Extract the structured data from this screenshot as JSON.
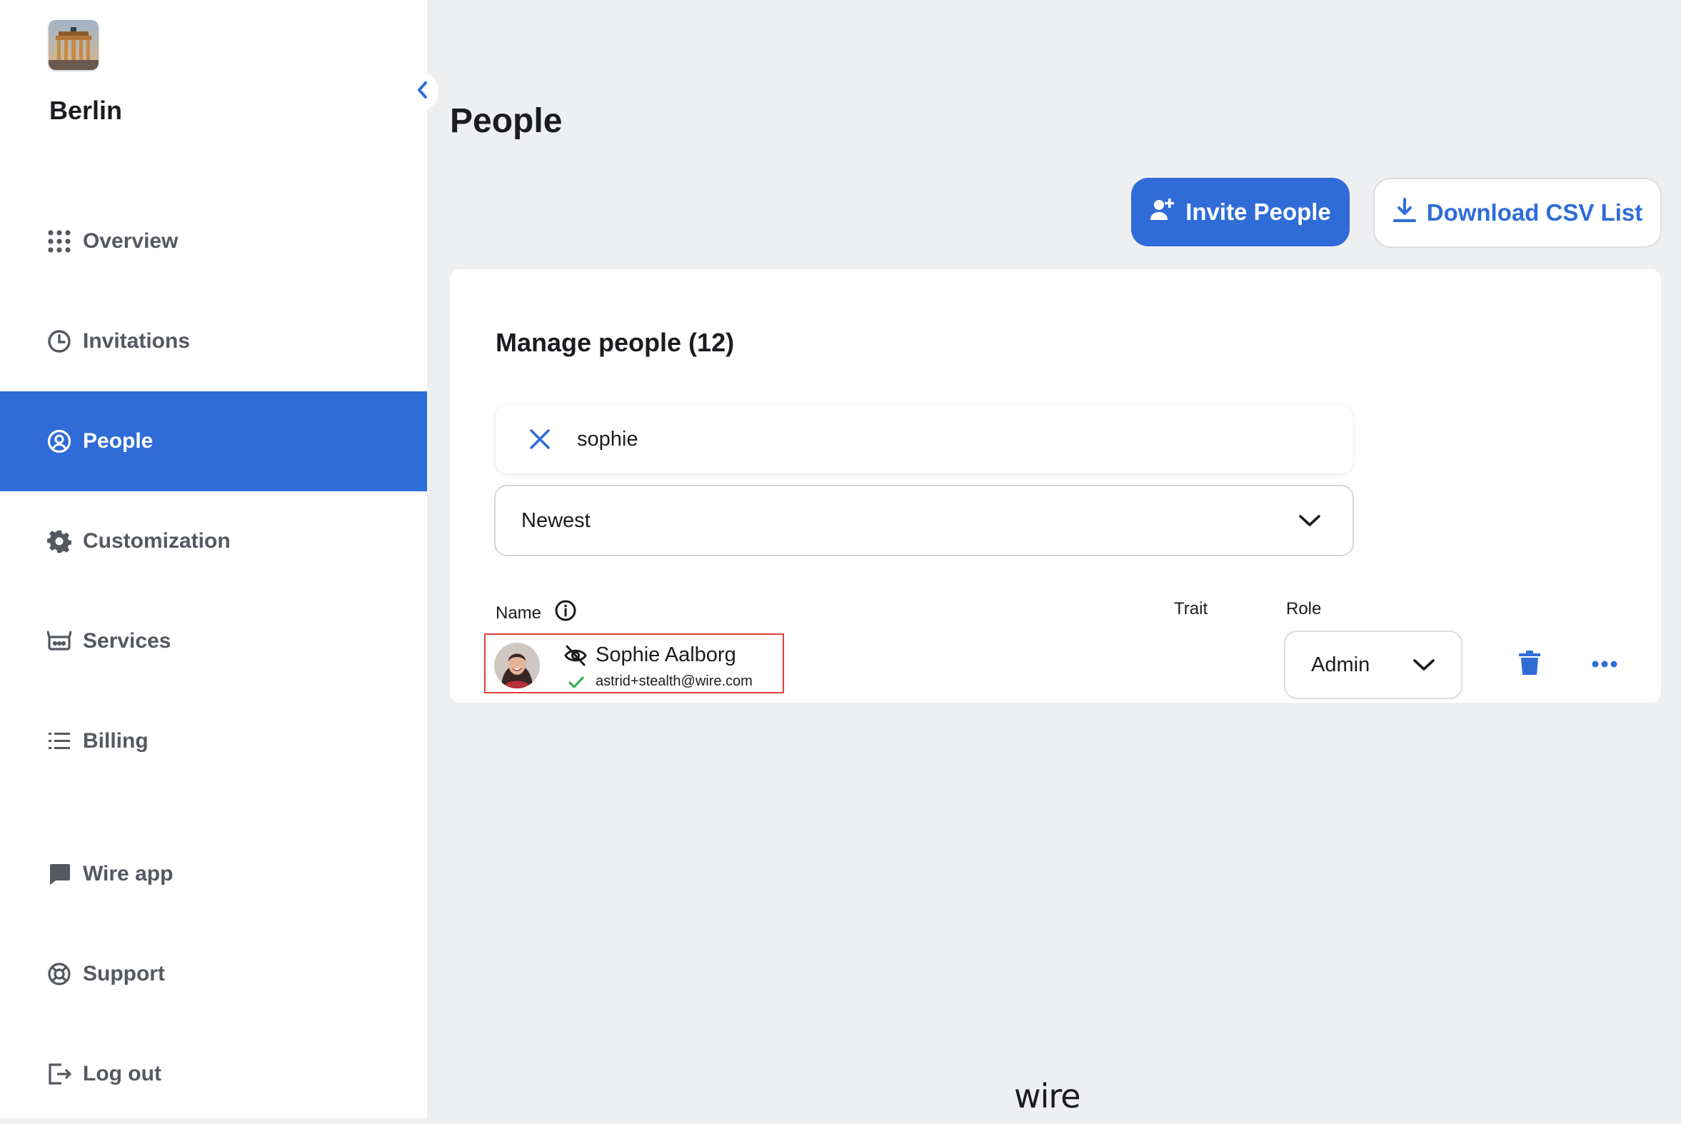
{
  "sidebar": {
    "team_name": "Berlin",
    "items": [
      {
        "label": "Overview",
        "icon": "grid-icon"
      },
      {
        "label": "Invitations",
        "icon": "clock-icon"
      },
      {
        "label": "People",
        "icon": "person-circle-icon",
        "active": true
      },
      {
        "label": "Customization",
        "icon": "gear-icon"
      },
      {
        "label": "Services",
        "icon": "robot-icon"
      },
      {
        "label": "Billing",
        "icon": "list-icon"
      },
      {
        "label": "Wire app",
        "icon": "chat-bubble-icon"
      },
      {
        "label": "Support",
        "icon": "lifebuoy-icon"
      },
      {
        "label": "Log out",
        "icon": "logout-icon"
      }
    ]
  },
  "main": {
    "page_title": "People",
    "invite_button": "Invite People",
    "download_button": "Download CSV List",
    "card_title": "Manage people (12)",
    "search_value": "sophie",
    "sort_value": "Newest",
    "columns": {
      "name": "Name",
      "trait": "Trait",
      "role": "Role"
    },
    "users": [
      {
        "name": "Sophie Aalborg",
        "email": "astrid+stealth@wire.com",
        "role": "Admin",
        "verified": true,
        "hidden": true
      }
    ]
  },
  "footer": {
    "brand": "wire"
  },
  "colors": {
    "accent": "#2f6cd8",
    "highlight_border": "#e2403a",
    "verified": "#2dab4a",
    "background": "#eeeff1"
  }
}
